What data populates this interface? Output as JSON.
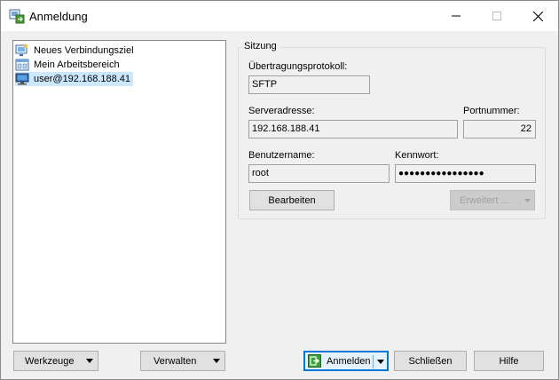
{
  "window": {
    "title": "Anmeldung",
    "controls": {
      "minimize": "—",
      "maximize": "☐",
      "close": "✕"
    }
  },
  "sites": [
    {
      "label": "Neues Verbindungsziel",
      "icon": "new-site-icon",
      "selected": false
    },
    {
      "label": "Mein Arbeitsbereich",
      "icon": "workspace-icon",
      "selected": false
    },
    {
      "label": "user@192.168.188.41",
      "icon": "computer-icon",
      "selected": true
    }
  ],
  "session": {
    "legend": "Sitzung",
    "protocol_label": "Übertragungsprotokoll:",
    "protocol_value": "SFTP",
    "host_label": "Serveradresse:",
    "host_value": "192.168.188.41",
    "port_label": "Portnummer:",
    "port_value": "22",
    "user_label": "Benutzername:",
    "user_value": "root",
    "password_label": "Kennwort:",
    "password_value": "●●●●●●●●●●●●●●●●",
    "edit_button": "Bearbeiten",
    "advanced_button": "Erweitert ..."
  },
  "footer": {
    "tools_button": "Werkzeuge",
    "manage_button": "Verwalten",
    "login_button": "Anmelden",
    "close_button": "Schließen",
    "help_button": "Hilfe"
  },
  "colors": {
    "selection": "#cce8ff",
    "accent": "#0078d7",
    "field_bg": "#f0f0f0"
  }
}
